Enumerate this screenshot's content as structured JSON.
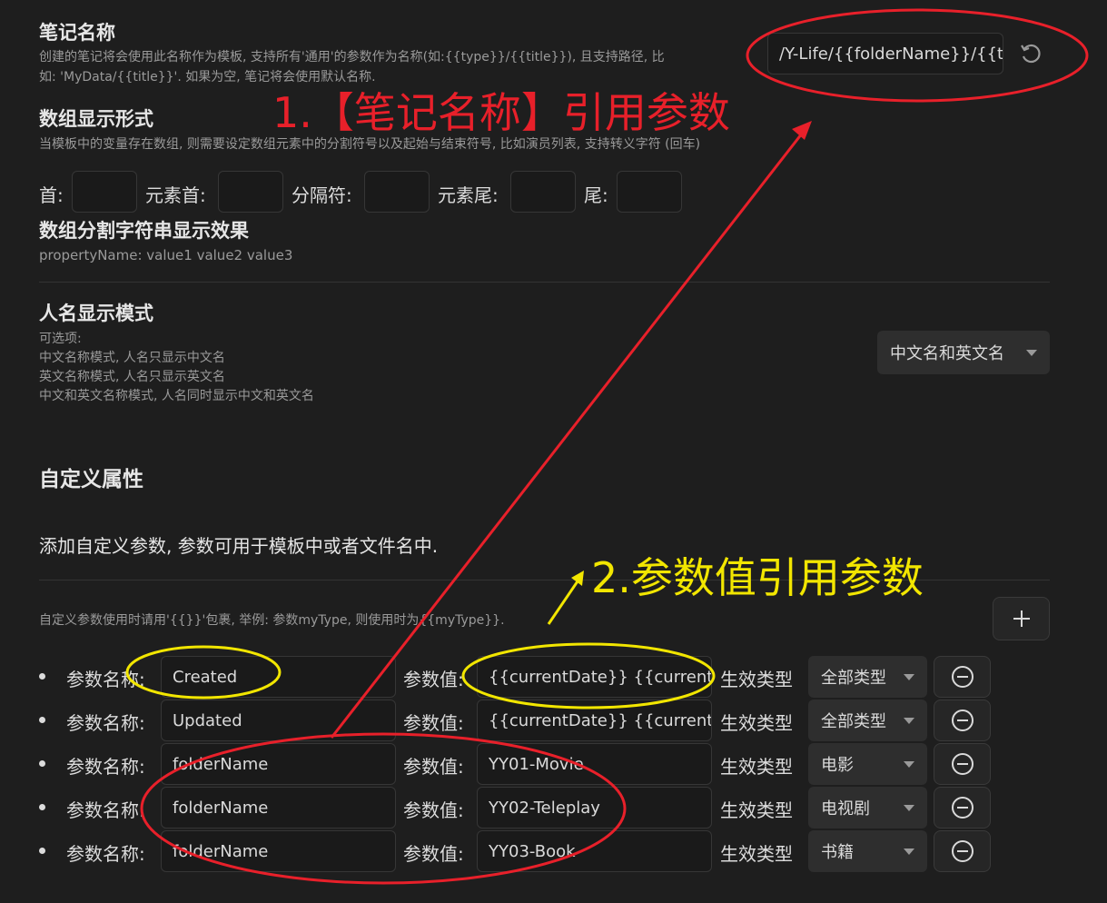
{
  "note_name": {
    "title": "笔记名称",
    "desc_line1": "创建的笔记将会使用此名称作为模板, 支持所有'通用'的参数作为名称(如:{{type}}/{{title}}), 且支持路径, 比",
    "desc_line2": "如: 'MyData/{{title}}'. 如果为空, 笔记将会使用默认名称.",
    "value": "/Y-Life/{{folderName}}/{{title}}"
  },
  "array_format": {
    "title": "数组显示形式",
    "desc": "当模板中的变量存在数组, 则需要设定数组元素中的分割符号以及起始与结束符号, 比如演员列表, 支持转义字符 (回车)",
    "labels": [
      "首:",
      "元素首:",
      "分隔符:",
      "元素尾:",
      "尾:"
    ]
  },
  "array_preview": {
    "title": "数组分割字符串显示效果",
    "value": "propertyName: value1 value2 value3"
  },
  "person_name": {
    "title": "人名显示模式",
    "desc": [
      "可选项:",
      "中文名称模式, 人名只显示中文名",
      "英文名称模式, 人名只显示英文名",
      "中文和英文名称模式, 人名同时显示中文和英文名"
    ],
    "selected": "中文名和英文名"
  },
  "custom": {
    "section_title": "自定义属性",
    "add_title": "添加自定义参数, 参数可用于模板中或者文件名中.",
    "hint": "自定义参数使用时请用'{{}}'包裹, 举例: 参数myType, 则使用时为{{myType}}.",
    "name_label": "参数名称:",
    "value_label": "参数值:",
    "type_label": "生效类型",
    "rows": [
      {
        "name": "Created",
        "value": "{{currentDate}} {{currentTime}}",
        "type": "全部类型"
      },
      {
        "name": "Updated",
        "value": "{{currentDate}} {{currentTime}}",
        "type": "全部类型"
      },
      {
        "name": "folderName",
        "value": "YY01-Movie",
        "type": "电影"
      },
      {
        "name": "folderName",
        "value": "YY02-Teleplay",
        "type": "电视剧"
      },
      {
        "name": "folderName",
        "value": "YY03-Book",
        "type": "书籍"
      }
    ]
  },
  "annotations": {
    "red_text": "1.【笔记名称】引用参数",
    "yellow_text": "2.参数值引用参数",
    "red_color": "#e8202a",
    "yellow_color": "#f2e600"
  },
  "icons": [
    "reset-icon",
    "plus-icon",
    "minus-circle-icon",
    "chevron-down-icon"
  ]
}
